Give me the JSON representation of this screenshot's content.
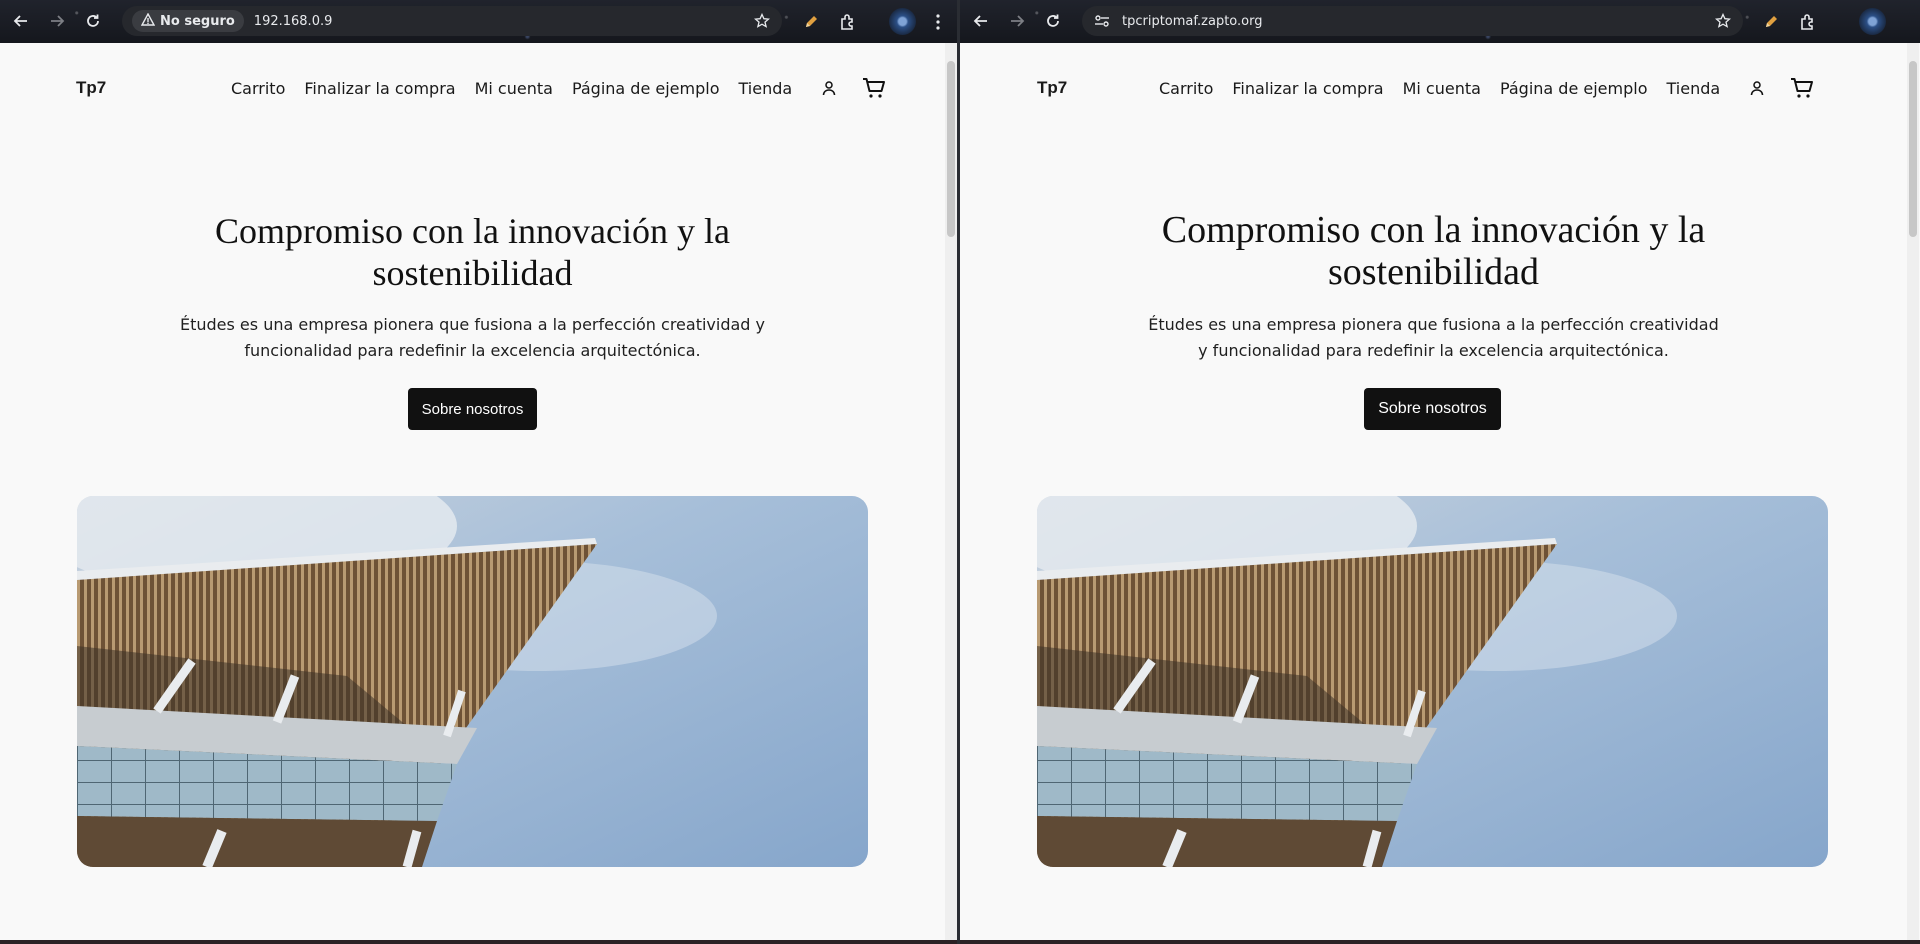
{
  "windows": [
    {
      "id": "left",
      "chrome": {
        "security_label": "No seguro",
        "url": "192.168.0.9"
      }
    },
    {
      "id": "right",
      "chrome": {
        "url": "tpcriptomaf.zapto.org"
      }
    }
  ],
  "site": {
    "title": "Tp7",
    "nav": [
      "Carrito",
      "Finalizar la compra",
      "Mi cuenta",
      "Página de ejemplo",
      "Tienda"
    ],
    "hero": {
      "title_line1": "Compromiso con la innovación y la",
      "title_line2": "sostenibilidad",
      "text_line1": "Études es una empresa pionera que fusiona a la perfección creatividad y",
      "text_line2": "funcionalidad para redefinir la excelencia arquitectónica.",
      "text_line1_right": "Études es una empresa pionera que fusiona a la perfección creatividad",
      "text_line2_right": "y funcionalidad para redefinir la excelencia arquitectónica.",
      "button": "Sobre nosotros"
    }
  },
  "colors": {
    "page_bg": "#f9f9f9",
    "text": "#111111",
    "button_bg": "#111111",
    "chrome_bg": "#1b1d24",
    "sky": "#8fb0d6"
  },
  "icons": [
    "back-arrow-icon",
    "forward-arrow-icon",
    "reload-icon",
    "warning-icon",
    "site-info-icon",
    "star-icon",
    "pen-icon",
    "extensions-icon",
    "profile-avatar",
    "more-menu-icon",
    "user-account-icon",
    "cart-icon"
  ]
}
